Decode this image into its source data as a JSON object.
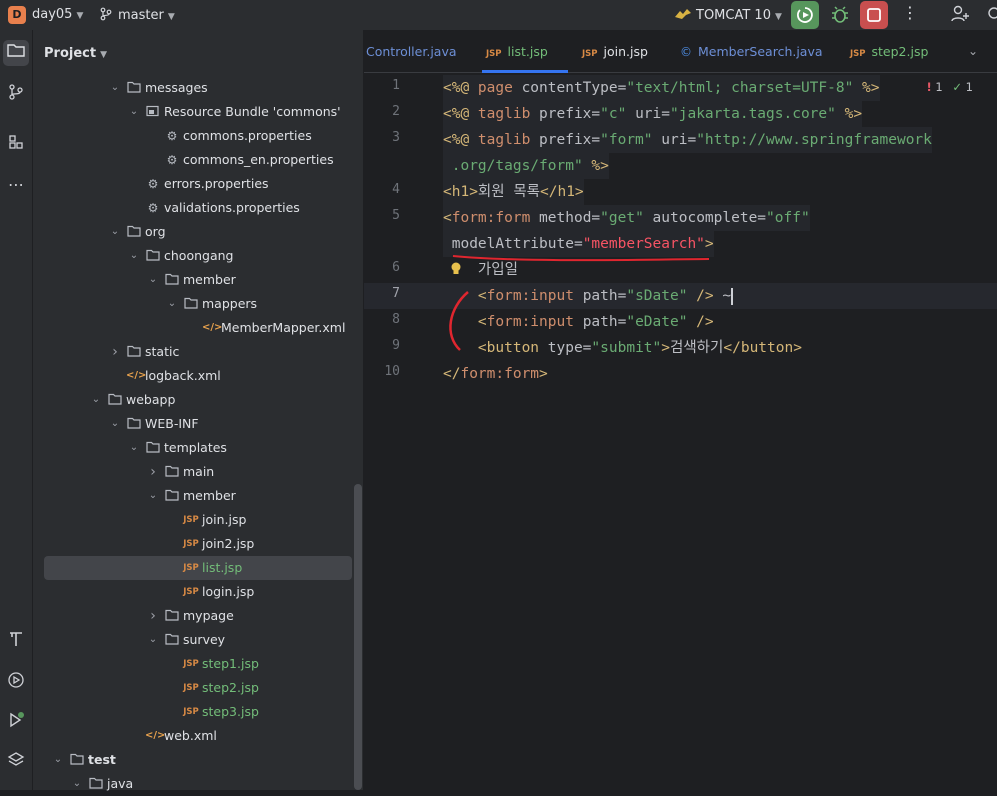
{
  "toolbar": {
    "project_badge": "D",
    "project_name": "day05",
    "branch": "master",
    "run_config": "TOMCAT 10",
    "colors": {
      "run": "#57965c",
      "stop": "#c94f4f"
    }
  },
  "left_strip": {
    "icons": [
      "folder-icon",
      "git-branch-icon",
      "structure-icon",
      "more-icon",
      "build-icon",
      "services-icon",
      "run-icon",
      "layers-icon"
    ]
  },
  "project_panel": {
    "title": "Project",
    "rows": [
      {
        "label": "messages",
        "icon": "folder",
        "arrow": "down",
        "indent": 0
      },
      {
        "label": "Resource Bundle 'commons'",
        "icon": "bundle",
        "arrow": "down",
        "indent": 1
      },
      {
        "label": "commons.properties",
        "icon": "gear",
        "arrow": "",
        "indent": 2
      },
      {
        "label": "commons_en.properties",
        "icon": "gear",
        "arrow": "",
        "indent": 2
      },
      {
        "label": "errors.properties",
        "icon": "gear",
        "arrow": "",
        "indent": 1
      },
      {
        "label": "validations.properties",
        "icon": "gear",
        "arrow": "",
        "indent": 1
      },
      {
        "label": "org",
        "icon": "folder",
        "arrow": "down",
        "indent": 0
      },
      {
        "label": "choongang",
        "icon": "folder",
        "arrow": "down",
        "indent": 1
      },
      {
        "label": "member",
        "icon": "folder",
        "arrow": "down",
        "indent": 2
      },
      {
        "label": "mappers",
        "icon": "folder",
        "arrow": "down",
        "indent": 3
      },
      {
        "label": "MemberMapper.xml",
        "icon": "xml",
        "arrow": "",
        "indent": 4
      },
      {
        "label": "static",
        "icon": "folder",
        "arrow": "right",
        "indent": 0
      },
      {
        "label": "logback.xml",
        "icon": "xml",
        "arrow": "",
        "indent": 0
      },
      {
        "label": "webapp",
        "icon": "folder",
        "arrow": "down",
        "indent": -1
      },
      {
        "label": "WEB-INF",
        "icon": "folder",
        "arrow": "down",
        "indent": 0
      },
      {
        "label": "templates",
        "icon": "folder",
        "arrow": "down",
        "indent": 1
      },
      {
        "label": "main",
        "icon": "folder",
        "arrow": "right",
        "indent": 2
      },
      {
        "label": "member",
        "icon": "folder",
        "arrow": "down",
        "indent": 2
      },
      {
        "label": "join.jsp",
        "icon": "jsp",
        "arrow": "",
        "indent": 3
      },
      {
        "label": "join2.jsp",
        "icon": "jsp",
        "arrow": "",
        "indent": 3
      },
      {
        "label": "list.jsp",
        "icon": "jsp",
        "arrow": "",
        "indent": 3,
        "selected": true,
        "green": true
      },
      {
        "label": "login.jsp",
        "icon": "jsp",
        "arrow": "",
        "indent": 3
      },
      {
        "label": "mypage",
        "icon": "folder",
        "arrow": "right",
        "indent": 2
      },
      {
        "label": "survey",
        "icon": "folder",
        "arrow": "down",
        "indent": 2
      },
      {
        "label": "step1.jsp",
        "icon": "jsp",
        "arrow": "",
        "indent": 3,
        "green": true
      },
      {
        "label": "step2.jsp",
        "icon": "jsp",
        "arrow": "",
        "indent": 3,
        "green": true
      },
      {
        "label": "step3.jsp",
        "icon": "jsp",
        "arrow": "",
        "indent": 3,
        "green": true
      },
      {
        "label": "web.xml",
        "icon": "xml",
        "arrow": "",
        "indent": 1
      },
      {
        "label": "test",
        "icon": "folder",
        "arrow": "down",
        "indent": -3
      },
      {
        "label": "java",
        "icon": "folder",
        "arrow": "down",
        "indent": -2
      }
    ]
  },
  "editor": {
    "tabs": [
      {
        "label": "Controller.java",
        "kind": "java"
      },
      {
        "label": "list.jsp",
        "kind": "jsp",
        "active": true
      },
      {
        "label": "join.jsp",
        "kind": "jsp"
      },
      {
        "label": "MemberSearch.java",
        "kind": "class"
      },
      {
        "label": "step2.jsp",
        "kind": "jsp"
      }
    ],
    "inspection": {
      "errors": "1",
      "warnings": "1"
    },
    "lines": [
      {
        "num": "1",
        "segs": [
          [
            "tagc",
            "<%@ "
          ],
          [
            "kw",
            "page "
          ],
          [
            "attr",
            "contentType="
          ],
          [
            "str",
            "\"text/html; charset=UTF-8\""
          ],
          [
            "tagc",
            " %>"
          ]
        ]
      },
      {
        "num": "2",
        "segs": [
          [
            "tagc",
            "<%@ "
          ],
          [
            "kw",
            "taglib "
          ],
          [
            "attr",
            "prefix="
          ],
          [
            "str",
            "\"c\""
          ],
          [
            "attr",
            " uri="
          ],
          [
            "str",
            "\"jakarta.tags.core\""
          ],
          [
            "tagc",
            " %>"
          ]
        ]
      },
      {
        "num": "3",
        "segs": [
          [
            "tagc",
            "<%@ "
          ],
          [
            "kw",
            "taglib "
          ],
          [
            "attr",
            "prefix="
          ],
          [
            "str",
            "\"form\""
          ],
          [
            "attr",
            " uri="
          ],
          [
            "str",
            "\"http://www.springframework"
          ]
        ]
      },
      {
        "num": "",
        "segs": [
          [
            "str",
            " .org/tags/form\""
          ],
          [
            "tagc",
            " %>"
          ]
        ]
      },
      {
        "num": "4",
        "segs": [
          [
            "tagc",
            "<h1>"
          ],
          [
            "txt",
            "회원 목록"
          ],
          [
            "tagc",
            "</h1>"
          ]
        ]
      },
      {
        "num": "5",
        "segs": [
          [
            "tagc",
            "<"
          ],
          [
            "ns",
            "form:form "
          ],
          [
            "attr",
            "method="
          ],
          [
            "str",
            "\"get\""
          ],
          [
            "attr",
            " autocomplete="
          ],
          [
            "str",
            "\"off\""
          ]
        ]
      },
      {
        "num": "",
        "segs": [
          [
            "attr",
            " modelAttribute="
          ],
          [
            "redstr",
            "\"memberSearch\""
          ],
          [
            "tagc",
            ">"
          ]
        ]
      },
      {
        "num": "6",
        "segs": [
          [
            "txt",
            "    가입일"
          ]
        ]
      },
      {
        "num": "7",
        "segs": [
          [
            "tagc",
            "    <"
          ],
          [
            "ns",
            "form:input "
          ],
          [
            "attr",
            "path="
          ],
          [
            "str",
            "\"sDate\""
          ],
          [
            "tagc",
            " />"
          ],
          [
            "txt",
            " ~"
          ]
        ]
      },
      {
        "num": "8",
        "segs": [
          [
            "tagc",
            "    <"
          ],
          [
            "ns",
            "form:input "
          ],
          [
            "attr",
            "path="
          ],
          [
            "str",
            "\"eDate\""
          ],
          [
            "tagc",
            " />"
          ]
        ]
      },
      {
        "num": "9",
        "segs": [
          [
            "tagc",
            "    <button "
          ],
          [
            "attr",
            "type="
          ],
          [
            "str",
            "\"submit\""
          ],
          [
            "tagc",
            ">"
          ],
          [
            "txt",
            "검색하기"
          ],
          [
            "tagc",
            "</button>"
          ]
        ]
      },
      {
        "num": "10",
        "segs": [
          [
            "tagc",
            "</"
          ],
          [
            "ns",
            "form:form"
          ],
          [
            "tagc",
            ">"
          ]
        ]
      }
    ]
  }
}
